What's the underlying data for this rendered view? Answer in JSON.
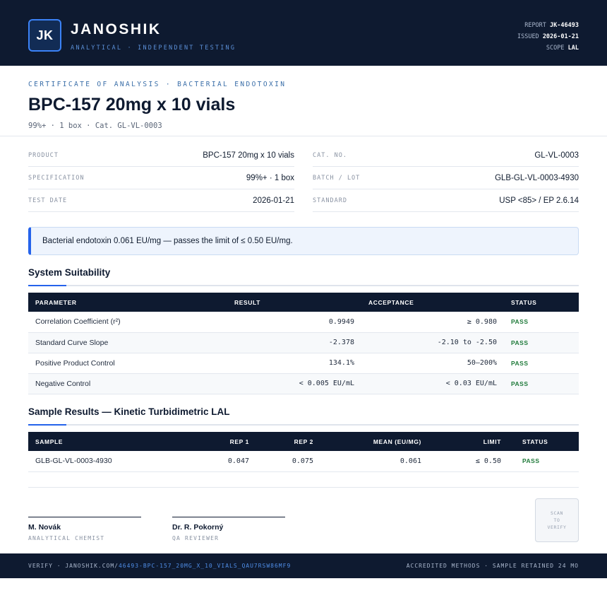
{
  "header": {
    "logo_text": "JK",
    "brand": "JANOSHIK",
    "tagline": "ANALYTICAL · INDEPENDENT TESTING",
    "report_label": "REPORT",
    "report_value": "JK-46493",
    "issued_label": "ISSUED",
    "issued_value": "2026-01-21",
    "scope_label": "SCOPE",
    "scope_value": "LAL"
  },
  "title_block": {
    "kicker": "CERTIFICATE OF ANALYSIS · BACTERIAL ENDOTOXIN",
    "title": "BPC-157 20mg x 10 vials",
    "subtitle": "99%+ · 1 box  ·  Cat. GL-VL-0003"
  },
  "info": {
    "left": [
      {
        "label": "PRODUCT",
        "value": "BPC-157 20mg x 10 vials"
      },
      {
        "label": "SPECIFICATION",
        "value": "99%+ · 1 box"
      },
      {
        "label": "TEST DATE",
        "value": "2026-01-21"
      }
    ],
    "right": [
      {
        "label": "CAT. NO.",
        "value": "GL-VL-0003"
      },
      {
        "label": "BATCH / LOT",
        "value": "GLB-GL-VL-0003-4930"
      },
      {
        "label": "STANDARD",
        "value": "USP <85> / EP 2.6.14"
      }
    ]
  },
  "banner": {
    "text": "Bacterial endotoxin 0.061 EU/mg — passes the limit of ≤ 0.50 EU/mg."
  },
  "system_suitability": {
    "title": "System Suitability",
    "headers": [
      "PARAMETER",
      "RESULT",
      "ACCEPTANCE",
      "STATUS"
    ],
    "rows": [
      {
        "parameter": "Correlation Coefficient (r²)",
        "result": "0.9949",
        "acceptance": "≥ 0.980",
        "status": "PASS"
      },
      {
        "parameter": "Standard Curve Slope",
        "result": "-2.378",
        "acceptance": "-2.10 to -2.50",
        "status": "PASS"
      },
      {
        "parameter": "Positive Product Control",
        "result": "134.1%",
        "acceptance": "50–200%",
        "status": "PASS"
      },
      {
        "parameter": "Negative Control",
        "result": "< 0.005 EU/mL",
        "acceptance": "< 0.03 EU/mL",
        "status": "PASS"
      }
    ]
  },
  "sample_results": {
    "title": "Sample Results — Kinetic Turbidimetric LAL",
    "headers": [
      "SAMPLE",
      "REP 1",
      "REP 2",
      "MEAN (EU/MG)",
      "LIMIT",
      "STATUS"
    ],
    "rows": [
      {
        "sample": "GLB-GL-VL-0003-4930",
        "rep1": "0.047",
        "rep2": "0.075",
        "mean": "0.061",
        "limit": "≤ 0.50",
        "status": "PASS"
      }
    ]
  },
  "signatures": [
    {
      "name": "M. Novák",
      "role": "ANALYTICAL CHEMIST"
    },
    {
      "name": "Dr. R. Pokorný",
      "role": "QA REVIEWER"
    }
  ],
  "qr": {
    "line1": "SCAN",
    "line2": "TO",
    "line3": "VERIFY"
  },
  "footer": {
    "verify_prefix": "VERIFY · JANOSHIK.COM/",
    "verify_url": "46493-BPC-157_20MG_X_10_VIALS_QAU7RSW86MF9",
    "right_text": "ACCREDITED METHODS · SAMPLE RETAINED 24 MO"
  }
}
